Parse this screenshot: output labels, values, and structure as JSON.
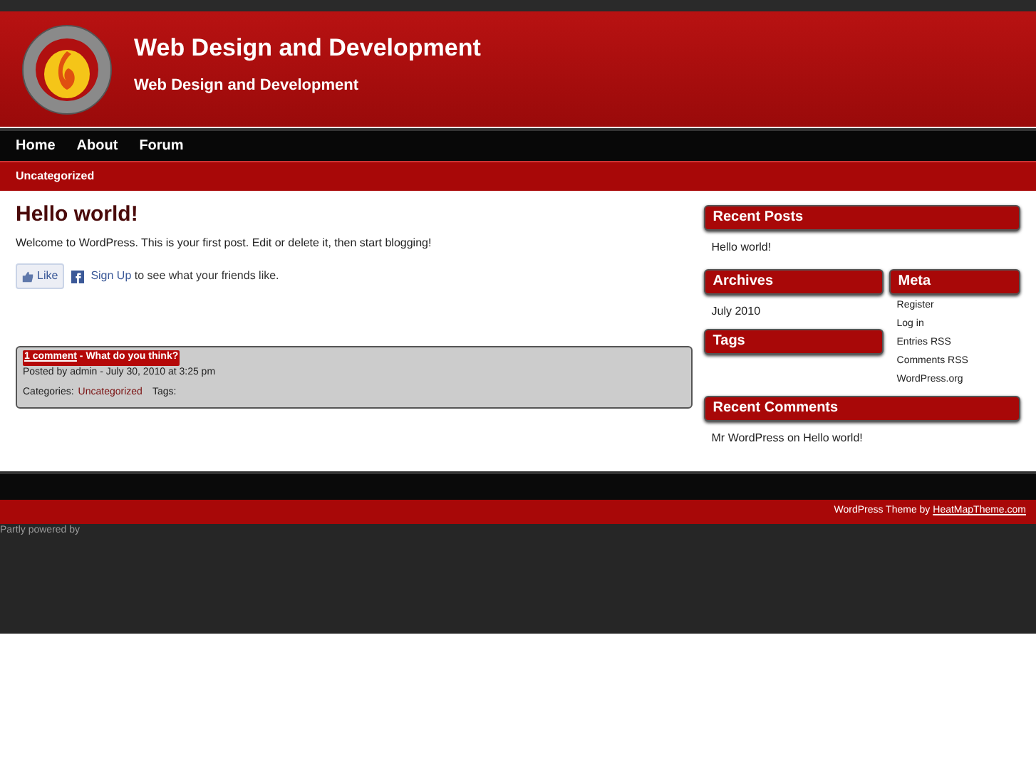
{
  "header": {
    "title": "Web Design and Development",
    "tagline": "Web Design and Development"
  },
  "nav": [
    {
      "label": "Home"
    },
    {
      "label": "About"
    },
    {
      "label": "Forum"
    }
  ],
  "category_bar": {
    "label": "Uncategorized"
  },
  "post": {
    "title": "Hello world!",
    "body": "Welcome to WordPress. This is your first post. Edit or delete it, then start blogging!",
    "like": {
      "button": "Like",
      "signup": "Sign Up",
      "text": "to see what your friends like."
    },
    "meta": {
      "comments_link": "1 comment",
      "comments_prompt": " - What do you think?",
      "posted": "Posted by admin - July 30, 2010 at 3:25 pm",
      "categories_label": "Categories:",
      "category": "Uncategorized",
      "tags_label": "Tags:"
    }
  },
  "sidebar": {
    "recent_posts": {
      "title": "Recent Posts",
      "items": [
        "Hello world!"
      ]
    },
    "archives": {
      "title": "Archives",
      "items": [
        "July 2010"
      ]
    },
    "meta": {
      "title": "Meta",
      "items": [
        "Register",
        "Log in",
        "Entries RSS",
        "Comments RSS",
        "WordPress.org"
      ]
    },
    "tags": {
      "title": "Tags"
    },
    "recent_comments": {
      "title": "Recent Comments",
      "items": [
        "Mr WordPress on Hello world!"
      ]
    }
  },
  "footer": {
    "credit": "WordPress Theme by",
    "credit_link": "HeatMapTheme.com",
    "powered": "Partly powered by"
  }
}
